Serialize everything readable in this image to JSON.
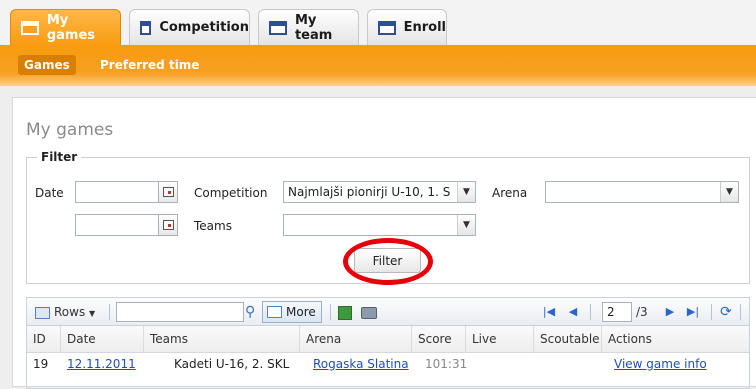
{
  "tabs": [
    {
      "label": "My games",
      "active": true
    },
    {
      "label": "Competition",
      "active": false
    },
    {
      "label": "My team",
      "active": false
    },
    {
      "label": "Enroll",
      "active": false
    }
  ],
  "subtabs": [
    {
      "label": "Games",
      "active": true
    },
    {
      "label": "Preferred time",
      "active": false
    }
  ],
  "page": {
    "title": "My games"
  },
  "filter": {
    "legend": "Filter",
    "date_label": "Date",
    "date_from": "",
    "date_to": "",
    "competition_label": "Competition",
    "competition_value": "Najmlajši pionirji U-10, 1. S",
    "teams_label": "Teams",
    "teams_value": "",
    "arena_label": "Arena",
    "arena_value": "",
    "filter_button": "Filter"
  },
  "grid_toolbar": {
    "rows_label": "Rows",
    "search_value": "",
    "more_label": "More",
    "current_page": "2",
    "total_pages": "/3"
  },
  "table": {
    "columns": [
      "ID",
      "Date",
      "Teams",
      "Arena",
      "Score",
      "Live",
      "Scoutable",
      "Actions"
    ],
    "rows": [
      {
        "id": "19",
        "date": "12.11.2011",
        "teams": "Kadeti U-16, 2. SKL",
        "arena": "Rogaska Slatina",
        "score": "101:31",
        "live": "",
        "scoutable": "",
        "action": "View game info"
      }
    ]
  },
  "colors": {
    "accent": "#f99b10",
    "link": "#1f4fb5",
    "highlight_ring": "#e5000a"
  }
}
